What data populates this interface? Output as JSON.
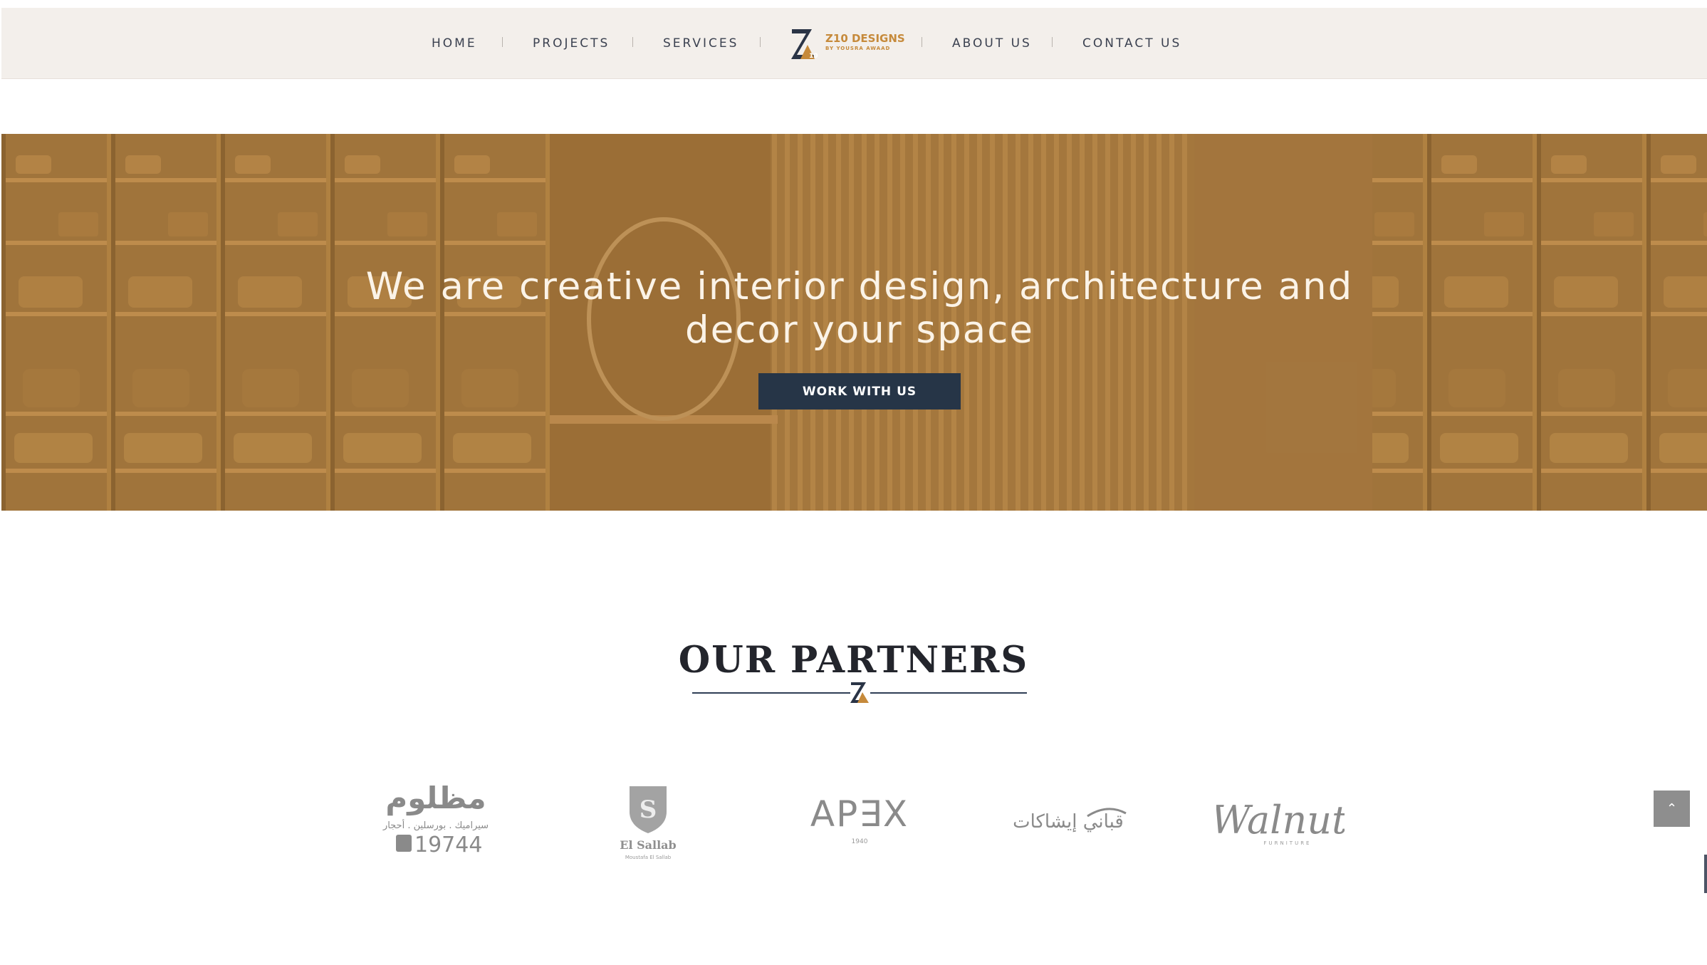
{
  "nav": {
    "items": [
      "HOME",
      "PROJECTS",
      "SERVICES",
      "ABOUT US",
      "CONTACT US"
    ],
    "logo_line1": "Z10 DESIGNS",
    "logo_line2": "BY YOUSRA AWAAD"
  },
  "hero": {
    "title": "We are creative interior design, architecture and decor your space",
    "button_label": "WORK WITH US"
  },
  "partners": {
    "title": "OUR PARTNERS",
    "logos": [
      {
        "name": "madloom",
        "line1": "مظلوم",
        "line2": "سيراميك . بورسلين . أحجار",
        "line3": "19744"
      },
      {
        "name": "el-sallab",
        "line1": "El Sallab",
        "line2": "Moustafa El Sallab"
      },
      {
        "name": "apex",
        "line1": "AP∃X",
        "line2": "1940"
      },
      {
        "name": "kabbany",
        "line1": "قباني إيشاكات"
      },
      {
        "name": "walnut",
        "line1": "Walnut",
        "line2": "FURNITURE"
      }
    ]
  },
  "scroll_top": {
    "label": "⌃"
  },
  "colors": {
    "nav_bg": "#f3efeb",
    "accent": "#c68a3b",
    "button": "#263547",
    "hero_overlay": "#a87635"
  }
}
